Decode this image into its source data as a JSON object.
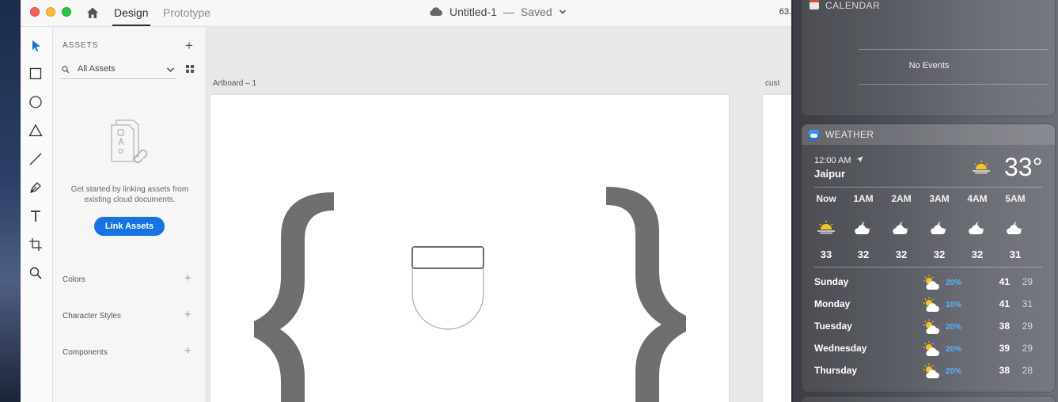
{
  "titlebar": {
    "tabs": [
      "Design",
      "Prototype"
    ],
    "doc_name": "Untitled-1",
    "separator": "—",
    "doc_status": "Saved",
    "zoom": "63."
  },
  "assets_panel": {
    "title": "ASSETS",
    "filter": "All Assets",
    "empty_text": "Get started by linking assets from existing cloud documents.",
    "link_button": "Link Assets",
    "sections": [
      "Colors",
      "Character Styles",
      "Components"
    ]
  },
  "canvas": {
    "artboard_label": "Artboard – 1",
    "artboard2_label": "cust",
    "shape_color": "#6e6e6e"
  },
  "calendar_widget": {
    "title": "CALENDAR",
    "no_events": "No Events"
  },
  "weather_widget": {
    "title": "WEATHER",
    "time": "12:00 AM",
    "city": "Jaipur",
    "temperature": "33°",
    "hours": [
      {
        "label": "Now",
        "temp": "33",
        "icon": "sunset-icon"
      },
      {
        "label": "1AM",
        "temp": "32",
        "icon": "partly-cloudy-night-icon"
      },
      {
        "label": "2AM",
        "temp": "32",
        "icon": "partly-cloudy-night-icon"
      },
      {
        "label": "3AM",
        "temp": "32",
        "icon": "partly-cloudy-night-icon"
      },
      {
        "label": "4AM",
        "temp": "32",
        "icon": "partly-cloudy-night-icon"
      },
      {
        "label": "5AM",
        "temp": "31",
        "icon": "partly-cloudy-night-icon"
      }
    ],
    "forecast": [
      {
        "day": "Sunday",
        "chance": "20%",
        "high": "41",
        "low": "29"
      },
      {
        "day": "Monday",
        "chance": "10%",
        "high": "41",
        "low": "31"
      },
      {
        "day": "Tuesday",
        "chance": "20%",
        "high": "38",
        "low": "29"
      },
      {
        "day": "Wednesday",
        "chance": "20%",
        "high": "39",
        "low": "29"
      },
      {
        "day": "Thursday",
        "chance": "20%",
        "high": "38",
        "low": "28"
      }
    ],
    "chance_color": "#4fb8ff"
  }
}
